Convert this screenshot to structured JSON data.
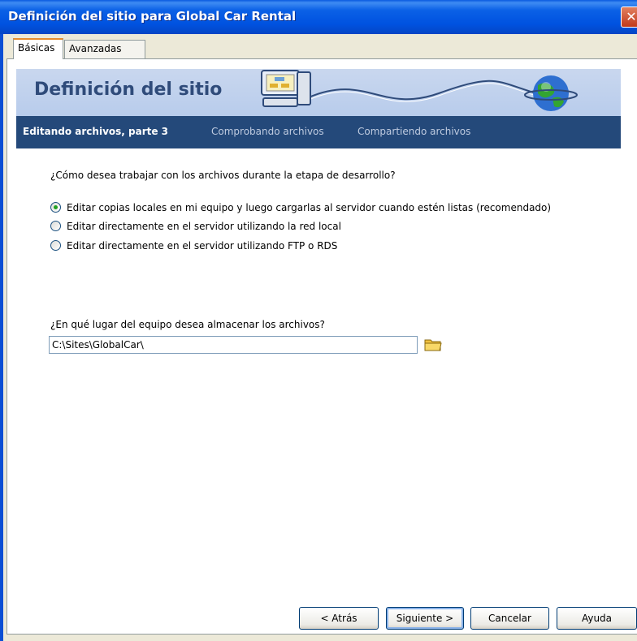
{
  "window": {
    "title": "Definición del sitio para Global Car Rental"
  },
  "tabs": [
    {
      "label": "Básicas",
      "active": true
    },
    {
      "label": "Avanzadas",
      "active": false
    }
  ],
  "banner": {
    "title": "Definición del sitio"
  },
  "steps": [
    {
      "label": "Editando archivos, parte 3",
      "current": true
    },
    {
      "label": "Comprobando archivos",
      "current": false
    },
    {
      "label": "Compartiendo archivos",
      "current": false
    }
  ],
  "work_question": "¿Cómo desea trabajar con los archivos durante la etapa de desarrollo?",
  "options": [
    {
      "label": "Editar copias locales en mi equipo y luego cargarlas al servidor cuando estén listas (recomendado)",
      "selected": true
    },
    {
      "label": "Editar directamente en el servidor utilizando la red local",
      "selected": false
    },
    {
      "label": "Editar directamente en el servidor utilizando FTP o RDS",
      "selected": false
    }
  ],
  "location_question": "¿En qué lugar del equipo desea almacenar los archivos?",
  "location_value": "C:\\Sites\\GlobalCar\\",
  "buttons": {
    "back": "< Atrás",
    "next": "Siguiente >",
    "cancel": "Cancelar",
    "help": "Ayuda"
  },
  "icons": {
    "close": "close-icon",
    "folder": "folder-icon",
    "computer": "computer-icon",
    "globe": "globe-icon"
  },
  "colors": {
    "titlebar": "#0052E0",
    "banner": "#C9D7EE",
    "steps_bar": "#24497A",
    "banner_title": "#2F4B7A"
  }
}
